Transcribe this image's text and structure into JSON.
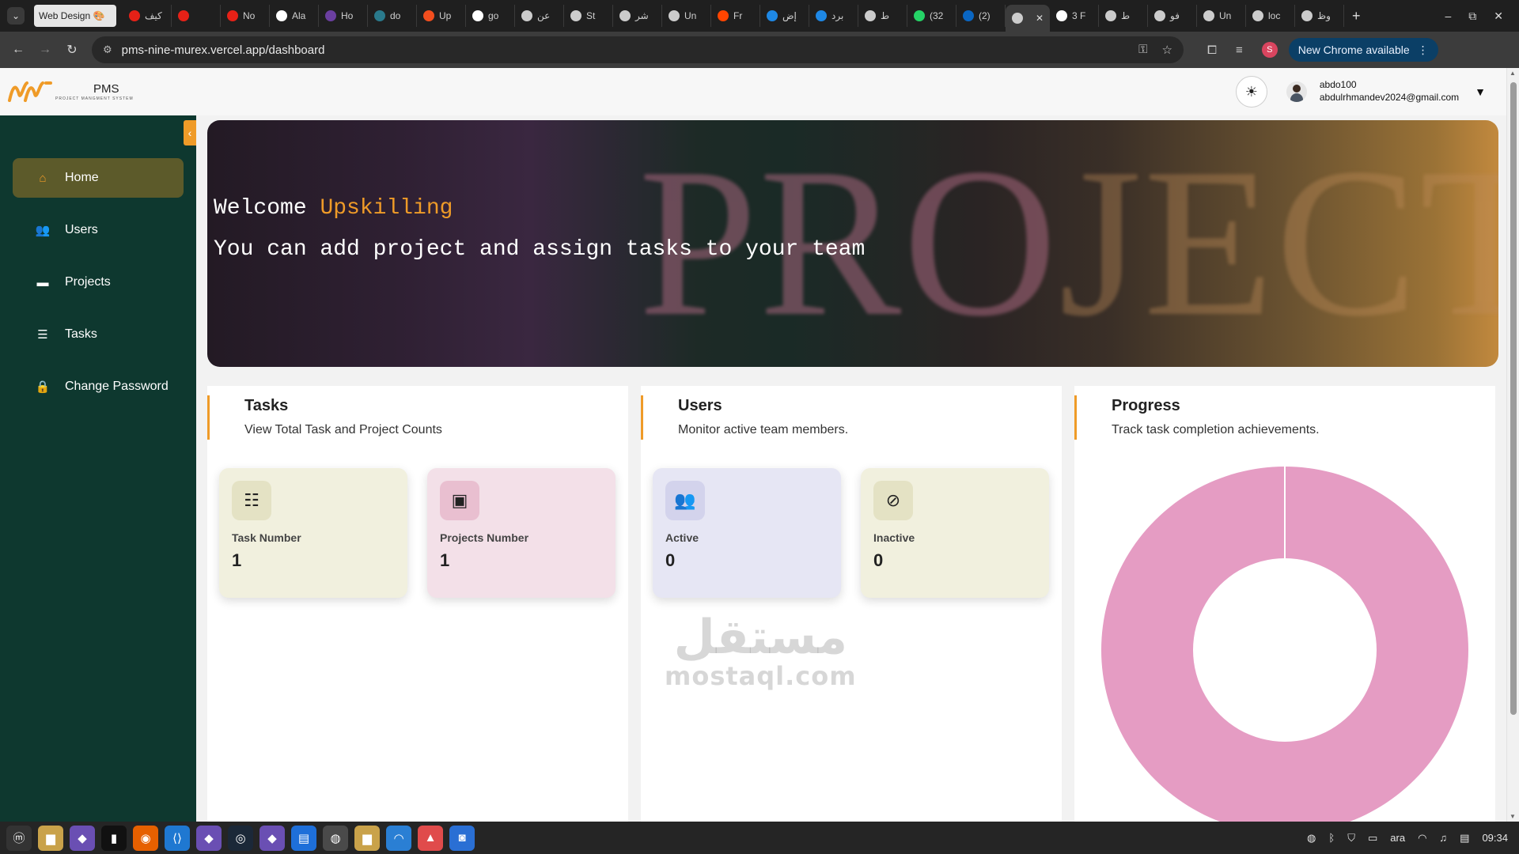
{
  "browser": {
    "group_tab_label": "Web Design 🎨",
    "tabs": [
      "كيف",
      "",
      "No",
      "Ala",
      "Ho",
      "do",
      "Up",
      "go",
      "عن",
      "St",
      "شر",
      "Un",
      "Fr",
      "إض",
      "برد",
      "ط",
      "(32",
      "(2)",
      "",
      "3 F",
      "ط",
      "فو",
      "Un",
      "loc",
      "وظ"
    ],
    "tab_colors": [
      "#e62117",
      "#e62117",
      "#e62117",
      "#ffffff",
      "#6b3fa0",
      "#2a7a8c",
      "#f24e1e",
      "#ffffff",
      "#cccccc",
      "#cccccc",
      "#cccccc",
      "#cccccc",
      "#ff4500",
      "#1e88e5",
      "#1e88e5",
      "#cccccc",
      "#25d366",
      "#0a66c2",
      "#cccccc",
      "#ffffff",
      "#cccccc",
      "#cccccc",
      "#cccccc",
      "#cccccc",
      "#cccccc"
    ],
    "url": "pms-nine-murex.vercel.app/dashboard",
    "update_label": "New Chrome available",
    "profile_initial": "S"
  },
  "header": {
    "logo_title": "PMS",
    "logo_subtitle": "PROJECT MANGMENT SYSTEM",
    "user_name": "abdo100",
    "user_email": "abdulrhmandev2024@gmail.com"
  },
  "sidebar": {
    "items": [
      {
        "label": "Home",
        "icon": "home-icon",
        "active": true
      },
      {
        "label": "Users",
        "icon": "users-icon",
        "active": false
      },
      {
        "label": "Projects",
        "icon": "folder-icon",
        "active": false
      },
      {
        "label": "Tasks",
        "icon": "list-icon",
        "active": false
      },
      {
        "label": "Change Password",
        "icon": "lock-icon",
        "active": false
      }
    ]
  },
  "hero": {
    "welcome": "Welcome",
    "name": "Upskilling",
    "subtitle": "You can add project and assign tasks to your team",
    "background_text": "PROJECTS"
  },
  "panels": {
    "tasks": {
      "title": "Tasks",
      "subtitle": "View Total Task and Project Counts",
      "stats": [
        {
          "label": "Task Number",
          "value": "1",
          "color": "#f1f0de",
          "icon_bg": "#e4e2c4",
          "icon": "task-list-icon"
        },
        {
          "label": "Projects Number",
          "value": "1",
          "color": "#f3e0e8",
          "icon_bg": "#e9bfd0",
          "icon": "presentation-icon"
        }
      ]
    },
    "users": {
      "title": "Users",
      "subtitle": "Monitor active team members.",
      "stats": [
        {
          "label": "Active",
          "value": "0",
          "color": "#e6e6f4",
          "icon_bg": "#d3d3ec",
          "icon": "users-group-icon"
        },
        {
          "label": "Inactive",
          "value": "0",
          "color": "#f1f0de",
          "icon_bg": "#e4e2c4",
          "icon": "users-slash-icon"
        }
      ]
    },
    "progress": {
      "title": "Progress",
      "subtitle": "Track task completion achievements."
    }
  },
  "chart_data": {
    "type": "pie",
    "title": "",
    "categories": [
      ""
    ],
    "values": [
      1
    ],
    "colors": [
      "#e59cc3"
    ],
    "inner_radius_ratio": 0.5
  },
  "watermark": {
    "arabic": "مستقل",
    "latin": "mostaql.com"
  },
  "taskbar": {
    "apps": [
      "menu-icon",
      "files-icon",
      "app-icon",
      "terminal-icon",
      "firefox-icon",
      "vscode-icon",
      "app-icon",
      "steam-icon",
      "app-icon",
      "writer-icon",
      "chrome-icon",
      "files-icon",
      "wifi-icon",
      "image-icon",
      "camera-icon"
    ],
    "keyboard_layout": "ara",
    "clock": "09:34"
  }
}
